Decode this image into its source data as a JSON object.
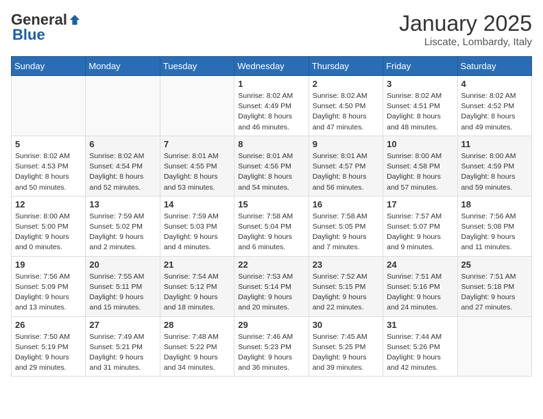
{
  "header": {
    "logo_general": "General",
    "logo_blue": "Blue",
    "month_title": "January 2025",
    "location": "Liscate, Lombardy, Italy"
  },
  "weekdays": [
    "Sunday",
    "Monday",
    "Tuesday",
    "Wednesday",
    "Thursday",
    "Friday",
    "Saturday"
  ],
  "weeks": [
    [
      {
        "day": "",
        "info": ""
      },
      {
        "day": "",
        "info": ""
      },
      {
        "day": "",
        "info": ""
      },
      {
        "day": "1",
        "info": "Sunrise: 8:02 AM\nSunset: 4:49 PM\nDaylight: 8 hours and 46 minutes."
      },
      {
        "day": "2",
        "info": "Sunrise: 8:02 AM\nSunset: 4:50 PM\nDaylight: 8 hours and 47 minutes."
      },
      {
        "day": "3",
        "info": "Sunrise: 8:02 AM\nSunset: 4:51 PM\nDaylight: 8 hours and 48 minutes."
      },
      {
        "day": "4",
        "info": "Sunrise: 8:02 AM\nSunset: 4:52 PM\nDaylight: 8 hours and 49 minutes."
      }
    ],
    [
      {
        "day": "5",
        "info": "Sunrise: 8:02 AM\nSunset: 4:53 PM\nDaylight: 8 hours and 50 minutes."
      },
      {
        "day": "6",
        "info": "Sunrise: 8:02 AM\nSunset: 4:54 PM\nDaylight: 8 hours and 52 minutes."
      },
      {
        "day": "7",
        "info": "Sunrise: 8:01 AM\nSunset: 4:55 PM\nDaylight: 8 hours and 53 minutes."
      },
      {
        "day": "8",
        "info": "Sunrise: 8:01 AM\nSunset: 4:56 PM\nDaylight: 8 hours and 54 minutes."
      },
      {
        "day": "9",
        "info": "Sunrise: 8:01 AM\nSunset: 4:57 PM\nDaylight: 8 hours and 56 minutes."
      },
      {
        "day": "10",
        "info": "Sunrise: 8:00 AM\nSunset: 4:58 PM\nDaylight: 8 hours and 57 minutes."
      },
      {
        "day": "11",
        "info": "Sunrise: 8:00 AM\nSunset: 4:59 PM\nDaylight: 8 hours and 59 minutes."
      }
    ],
    [
      {
        "day": "12",
        "info": "Sunrise: 8:00 AM\nSunset: 5:00 PM\nDaylight: 9 hours and 0 minutes."
      },
      {
        "day": "13",
        "info": "Sunrise: 7:59 AM\nSunset: 5:02 PM\nDaylight: 9 hours and 2 minutes."
      },
      {
        "day": "14",
        "info": "Sunrise: 7:59 AM\nSunset: 5:03 PM\nDaylight: 9 hours and 4 minutes."
      },
      {
        "day": "15",
        "info": "Sunrise: 7:58 AM\nSunset: 5:04 PM\nDaylight: 9 hours and 6 minutes."
      },
      {
        "day": "16",
        "info": "Sunrise: 7:58 AM\nSunset: 5:05 PM\nDaylight: 9 hours and 7 minutes."
      },
      {
        "day": "17",
        "info": "Sunrise: 7:57 AM\nSunset: 5:07 PM\nDaylight: 9 hours and 9 minutes."
      },
      {
        "day": "18",
        "info": "Sunrise: 7:56 AM\nSunset: 5:08 PM\nDaylight: 9 hours and 11 minutes."
      }
    ],
    [
      {
        "day": "19",
        "info": "Sunrise: 7:56 AM\nSunset: 5:09 PM\nDaylight: 9 hours and 13 minutes."
      },
      {
        "day": "20",
        "info": "Sunrise: 7:55 AM\nSunset: 5:11 PM\nDaylight: 9 hours and 15 minutes."
      },
      {
        "day": "21",
        "info": "Sunrise: 7:54 AM\nSunset: 5:12 PM\nDaylight: 9 hours and 18 minutes."
      },
      {
        "day": "22",
        "info": "Sunrise: 7:53 AM\nSunset: 5:14 PM\nDaylight: 9 hours and 20 minutes."
      },
      {
        "day": "23",
        "info": "Sunrise: 7:52 AM\nSunset: 5:15 PM\nDaylight: 9 hours and 22 minutes."
      },
      {
        "day": "24",
        "info": "Sunrise: 7:51 AM\nSunset: 5:16 PM\nDaylight: 9 hours and 24 minutes."
      },
      {
        "day": "25",
        "info": "Sunrise: 7:51 AM\nSunset: 5:18 PM\nDaylight: 9 hours and 27 minutes."
      }
    ],
    [
      {
        "day": "26",
        "info": "Sunrise: 7:50 AM\nSunset: 5:19 PM\nDaylight: 9 hours and 29 minutes."
      },
      {
        "day": "27",
        "info": "Sunrise: 7:49 AM\nSunset: 5:21 PM\nDaylight: 9 hours and 31 minutes."
      },
      {
        "day": "28",
        "info": "Sunrise: 7:48 AM\nSunset: 5:22 PM\nDaylight: 9 hours and 34 minutes."
      },
      {
        "day": "29",
        "info": "Sunrise: 7:46 AM\nSunset: 5:23 PM\nDaylight: 9 hours and 36 minutes."
      },
      {
        "day": "30",
        "info": "Sunrise: 7:45 AM\nSunset: 5:25 PM\nDaylight: 9 hours and 39 minutes."
      },
      {
        "day": "31",
        "info": "Sunrise: 7:44 AM\nSunset: 5:26 PM\nDaylight: 9 hours and 42 minutes."
      },
      {
        "day": "",
        "info": ""
      }
    ]
  ]
}
